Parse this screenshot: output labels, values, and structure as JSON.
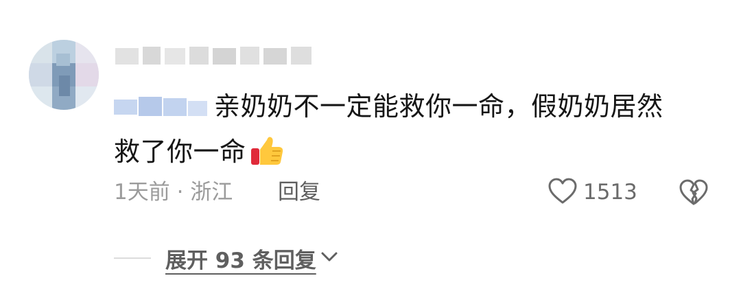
{
  "comment": {
    "author_name": "",
    "mention": "",
    "text_line1": "亲奶奶不一定能救你一命，假奶奶居然",
    "text_line2": "救了你一命",
    "emoji": "thumbs-up-icon"
  },
  "meta": {
    "time_location": "1天前 · 浙江",
    "reply_label": "回复"
  },
  "actions": {
    "like_count": "1513",
    "like_icon": "heart-outline-icon",
    "dislike_icon": "broken-heart-icon"
  },
  "replies": {
    "expand_label": "展开 93 条回复",
    "expand_icon": "chevron-down-icon"
  },
  "colors": {
    "text_primary": "#161616",
    "text_secondary": "#9b9b9b",
    "text_action": "#5f5f5f",
    "divider": "#dcdcdc"
  }
}
